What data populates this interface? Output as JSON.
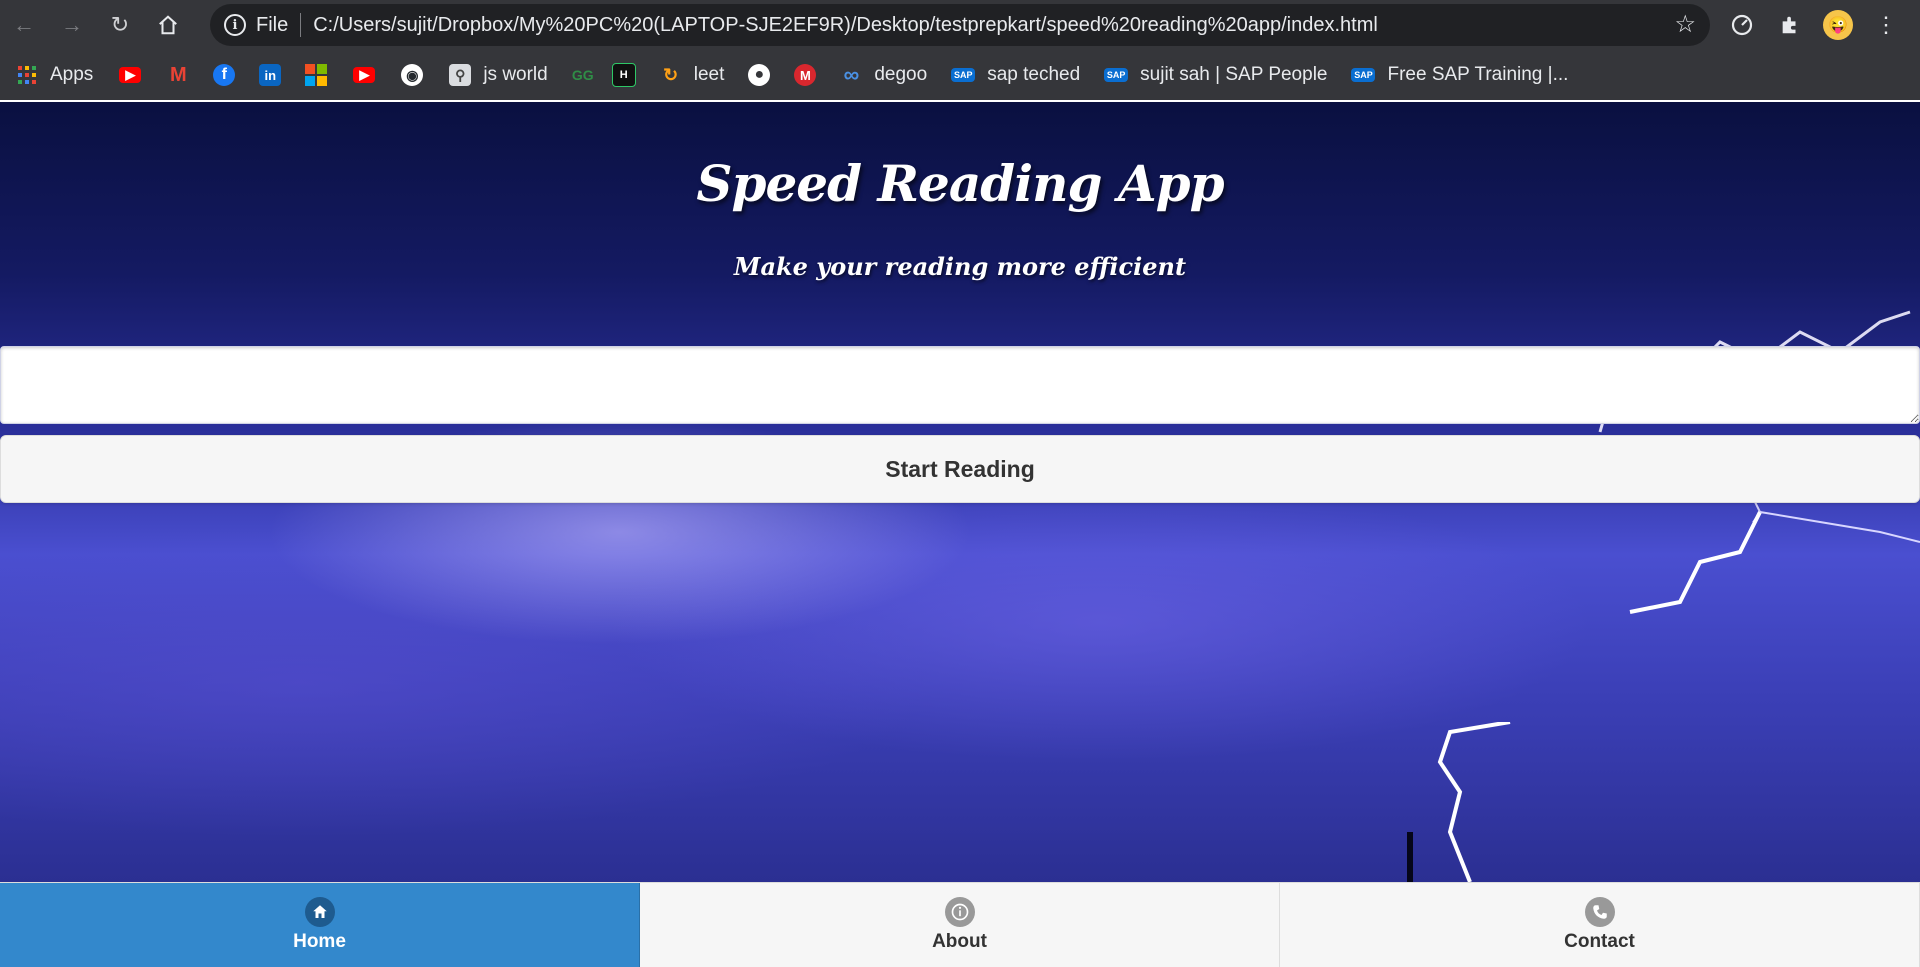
{
  "browser": {
    "url_scheme": "File",
    "url": "C:/Users/sujit/Dropbox/My%20PC%20(LAPTOP-SJE2EF9R)/Desktop/testprepkart/speed%20reading%20app/index.html",
    "nav_icons": [
      "back-arrow-icon",
      "forward-arrow-icon",
      "reload-icon",
      "home-icon"
    ],
    "extensions": [
      "speed-dial-icon",
      "puzzle-icon",
      "profile-avatar",
      "menu-dots-icon"
    ]
  },
  "bookmarks": [
    {
      "label": "Apps",
      "icon": "apps-grid-icon",
      "color": "#ea4335"
    },
    {
      "label": "",
      "icon": "youtube-icon",
      "color": "#ff0000"
    },
    {
      "label": "",
      "icon": "gmail-icon",
      "color": "#ea4335"
    },
    {
      "label": "",
      "icon": "facebook-icon",
      "color": "#1877f2"
    },
    {
      "label": "",
      "icon": "linkedin-icon",
      "color": "#0a66c2"
    },
    {
      "label": "",
      "icon": "microsoft-icon",
      "color": "#f25022"
    },
    {
      "label": "",
      "icon": "youtube-icon",
      "color": "#ff0000"
    },
    {
      "label": "",
      "icon": "github-icon",
      "color": "#ffffff"
    },
    {
      "label": "js world",
      "icon": "search-doc-icon",
      "color": "#cccccc"
    },
    {
      "label": "",
      "icon": "geeksforgeeks-icon",
      "color": "#2f8d46"
    },
    {
      "label": "",
      "icon": "hackerrank-icon",
      "color": "#111111"
    },
    {
      "label": "leet",
      "icon": "leetcode-icon",
      "color": "#ffa116"
    },
    {
      "label": "",
      "icon": "globe-icon",
      "color": "#ffffff"
    },
    {
      "label": "",
      "icon": "mega-icon",
      "color": "#d9272e"
    },
    {
      "label": "degoo",
      "icon": "infinity-icon",
      "color": "#4a90e2"
    },
    {
      "label": "sap teched",
      "icon": "sap-icon",
      "color": "#0a6ed1"
    },
    {
      "label": "sujit sah | SAP People",
      "icon": "sap-icon",
      "color": "#0a6ed1"
    },
    {
      "label": "Free SAP Training |...",
      "icon": "sap-icon",
      "color": "#0a6ed1"
    }
  ],
  "app": {
    "title": "Speed Reading App",
    "subtitle": "Make your reading more efficient",
    "textarea_value": "",
    "start_button_label": "Start Reading"
  },
  "footer_nav": [
    {
      "label": "Home",
      "icon": "home-icon",
      "active": true
    },
    {
      "label": "About",
      "icon": "info-icon",
      "active": false
    },
    {
      "label": "Contact",
      "icon": "phone-icon",
      "active": false
    }
  ],
  "colors": {
    "active_tab": "#3388cc",
    "browser_chrome": "#35363a"
  }
}
